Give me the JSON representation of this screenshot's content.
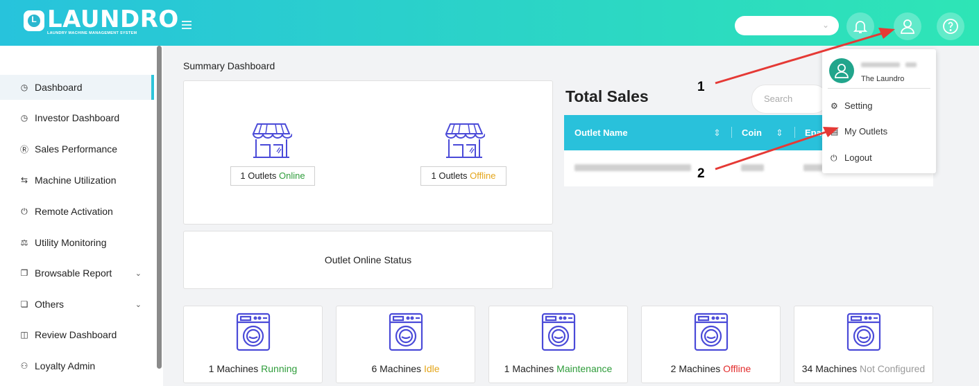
{
  "header": {
    "logo_text": "LAUNDRO",
    "logo_badge": "L",
    "logo_subtitle": "LAUNDRY MACHINE MANAGEMENT SYSTEM",
    "outlet_select_value": "",
    "accent_color": "#29c1db"
  },
  "sidebar": {
    "items": [
      {
        "label": "Dashboard",
        "icon": "dashboard-gauge-icon"
      },
      {
        "label": "Investor Dashboard",
        "icon": "gauge-icon"
      },
      {
        "label": "Sales Performance",
        "icon": "dollar-circle-icon"
      },
      {
        "label": "Machine Utilization",
        "icon": "swap-arrows-icon"
      },
      {
        "label": "Remote Activation",
        "icon": "power-icon"
      },
      {
        "label": "Utility Monitoring",
        "icon": "flask-icon"
      },
      {
        "label": "Browsable Report",
        "icon": "document-icon"
      },
      {
        "label": "Others",
        "icon": "folder-icon"
      },
      {
        "label": "Review Dashboard",
        "icon": "review-icon"
      },
      {
        "label": "Loyalty Admin",
        "icon": "users-icon"
      }
    ]
  },
  "main": {
    "page_title": "Summary Dashboard",
    "outlets": {
      "online_count": "1 Outlets",
      "online_label": "Online",
      "offline_count": "1 Outlets",
      "offline_label": "Offline"
    },
    "status_title": "Outlet Online Status",
    "sales": {
      "title": "Total Sales",
      "search_placeholder": "Search",
      "columns": [
        "Outlet Name",
        "Coin",
        "Epay"
      ]
    },
    "machines": [
      {
        "count": "1 Machines",
        "status": "Running"
      },
      {
        "count": "6 Machines",
        "status": "Idle"
      },
      {
        "count": "1 Machines",
        "status": "Maintenance"
      },
      {
        "count": "2 Machines",
        "status": "Offline"
      },
      {
        "count": "34 Machines",
        "status": "Not Configured"
      }
    ]
  },
  "user_menu": {
    "org": "The Laundro",
    "items": [
      {
        "label": "Setting",
        "icon": "gear-icon"
      },
      {
        "label": "My Outlets",
        "icon": "store-icon"
      },
      {
        "label": "Logout",
        "icon": "power-icon"
      }
    ]
  },
  "annotations": {
    "one": "1",
    "two": "2"
  }
}
